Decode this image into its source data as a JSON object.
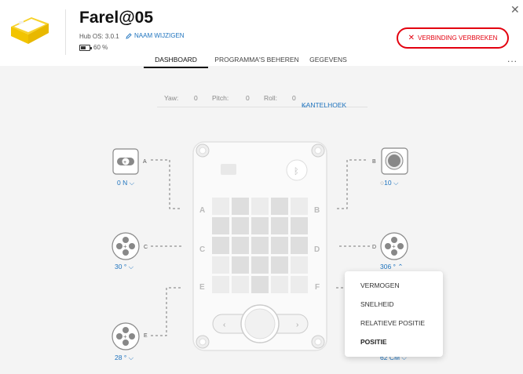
{
  "header": {
    "hub_name": "Farel@05",
    "hub_os": "Hub OS: 3.0.1",
    "rename_label": "NAAM WIJZIGEN",
    "battery": "60 %",
    "battery_fraction": 0.6,
    "disconnect_label": "VERBINDING VERBREKEN",
    "more_menu": "..."
  },
  "tabs": [
    {
      "label": "DASHBOARD",
      "active": true
    },
    {
      "label": "PROGRAMMA'S BEHEREN",
      "active": false
    },
    {
      "label": "GEGEVENS",
      "active": false
    }
  ],
  "imu": {
    "yaw_label": "Yaw:",
    "yaw_value": "0",
    "pitch_label": "Pitch:",
    "pitch_value": "0",
    "roll_label": "Roll:",
    "roll_value": "0",
    "mode": "KANTELHOEK"
  },
  "hub_ports": {
    "a": "A",
    "b": "B",
    "c": "C",
    "d": "D",
    "e": "E",
    "f": "F"
  },
  "ports": {
    "a": {
      "letter": "A",
      "value": "0 N"
    },
    "b": {
      "letter": "B",
      "value": "10"
    },
    "c": {
      "letter": "C",
      "value": "30 °"
    },
    "d": {
      "letter": "D",
      "value": "306 °"
    },
    "e": {
      "letter": "E",
      "value": "28 °"
    },
    "f": {
      "value": "62 CM"
    }
  },
  "dropdown": {
    "items": [
      "VERMOGEN",
      "SNELHEID",
      "RELATIEVE POSITIE",
      "POSITIE"
    ]
  },
  "colors": {
    "accent": "#1e73be",
    "danger": "#e3000f"
  }
}
